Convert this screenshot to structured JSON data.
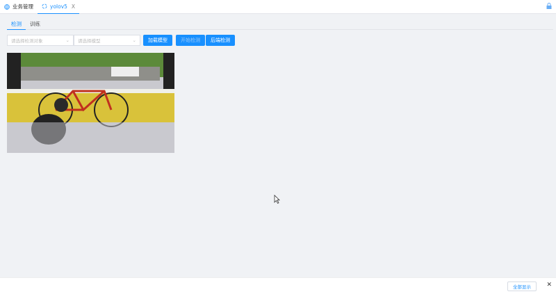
{
  "tabs": [
    {
      "label": "业务管理",
      "icon": "globe-icon"
    },
    {
      "label": "yolov5",
      "icon": "loading-icon",
      "close": "X"
    }
  ],
  "subtabs": [
    "检测",
    "训练"
  ],
  "toolbar": {
    "target_placeholder": "请选择检测对象",
    "model_placeholder": "请选择模型",
    "load_model": "加载模型",
    "start_detect": "开始检测",
    "backend_detect": "后端检测"
  },
  "footer": {
    "show_all": "全部显示",
    "close": "✕"
  },
  "colors": {
    "accent": "#1890ff"
  }
}
